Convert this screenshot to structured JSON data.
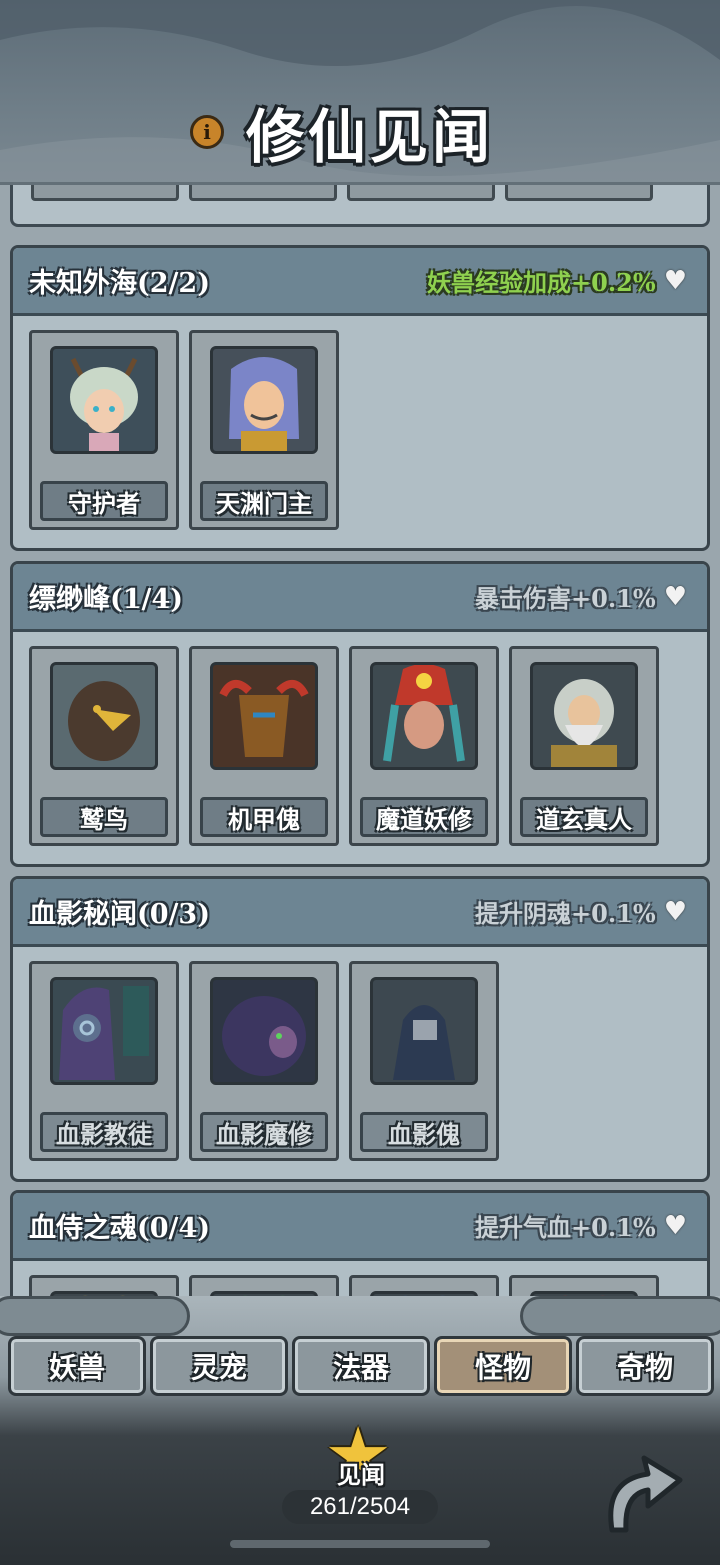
{
  "header": {
    "title": "修仙见闻",
    "info_icon": "info-icon"
  },
  "sections": [
    {
      "title": "未知外海(2/2)",
      "bonus": "妖兽经验加成+0.2%",
      "bonus_active": true,
      "cards": [
        {
          "name": "守护者"
        },
        {
          "name": "天渊门主"
        }
      ]
    },
    {
      "title": "缥缈峰(1/4)",
      "bonus": "暴击伤害+0.1%",
      "bonus_active": false,
      "cards": [
        {
          "name": "鹫鸟"
        },
        {
          "name": "机甲傀"
        },
        {
          "name": "魔道妖修"
        },
        {
          "name": "道玄真人"
        }
      ]
    },
    {
      "title": "血影秘闻(0/3)",
      "bonus": "提升阴魂+0.1%",
      "bonus_active": false,
      "cards": [
        {
          "name": "血影教徒"
        },
        {
          "name": "血影魔修"
        },
        {
          "name": "血影傀"
        }
      ]
    },
    {
      "title": "血侍之魂(0/4)",
      "bonus": "提升气血+0.1%",
      "bonus_active": false
    }
  ],
  "tabs": [
    {
      "label": "妖兽",
      "active": false
    },
    {
      "label": "灵宠",
      "active": false
    },
    {
      "label": "法器",
      "active": false
    },
    {
      "label": "怪物",
      "active": true
    },
    {
      "label": "奇物",
      "active": false
    }
  ],
  "footer": {
    "star_label": "见闻",
    "progress": "261/2504",
    "back_icon": "curved-arrow-icon"
  },
  "colors": {
    "bonus_active": "#8fd14f",
    "tab_active": "#a39078",
    "section_header": "#6d8593"
  }
}
